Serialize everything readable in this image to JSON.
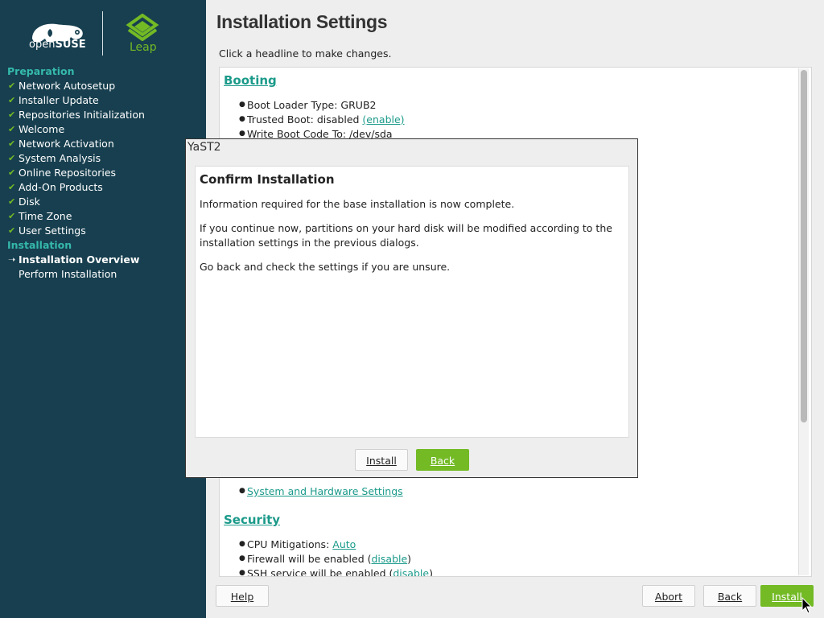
{
  "sidebar": {
    "brand": {
      "suse_prefix": "open",
      "suse_bold": "SUSE",
      "leap": "Leap"
    },
    "sections": [
      {
        "title": "Preparation",
        "steps": [
          {
            "label": "Network Autosetup",
            "state": "done"
          },
          {
            "label": "Installer Update",
            "state": "done"
          },
          {
            "label": "Repositories Initialization",
            "state": "done"
          },
          {
            "label": "Welcome",
            "state": "done"
          },
          {
            "label": "Network Activation",
            "state": "done"
          },
          {
            "label": "System Analysis",
            "state": "done"
          },
          {
            "label": "Online Repositories",
            "state": "done"
          },
          {
            "label": "Add-On Products",
            "state": "done"
          },
          {
            "label": "Disk",
            "state": "done"
          },
          {
            "label": "Time Zone",
            "state": "done"
          },
          {
            "label": "User Settings",
            "state": "done"
          }
        ]
      },
      {
        "title": "Installation",
        "steps": [
          {
            "label": "Installation Overview",
            "state": "current"
          },
          {
            "label": "Perform Installation",
            "state": "pending"
          }
        ]
      }
    ],
    "marks": {
      "done": "✔",
      "current": "➝"
    }
  },
  "main": {
    "title": "Installation Settings",
    "subtitle": "Click a headline to make changes.",
    "booting": {
      "headline": "Booting",
      "loader": "Boot Loader Type: GRUB2",
      "trusted_prefix": "Trusted Boot: disabled ",
      "trusted_link": "(enable)",
      "write_code": "Write Boot Code To: /dev/sda"
    },
    "system_link": "System and Hardware Settings",
    "security": {
      "headline": "Security",
      "cpu_prefix": "CPU Mitigations: ",
      "cpu_link": "Auto",
      "firewall_prefix": "Firewall will be enabled (",
      "firewall_link": "disable",
      "firewall_suffix": ")",
      "ssh_prefix": "SSH service will be enabled (",
      "ssh_link": "disable",
      "ssh_suffix": ")"
    }
  },
  "buttons": {
    "help": "Help",
    "abort": "Abort",
    "back": "Back",
    "install": "Install"
  },
  "dialog": {
    "window_title": "YaST2",
    "heading": "Confirm Installation",
    "p1": "Information required for the base installation is now complete.",
    "p2": "If you continue now, partitions on your hard disk will be modified according to the installation settings in the previous dialogs.",
    "p3": "Go back and check the settings if you are unsure.",
    "install": "Install",
    "back": "Back"
  },
  "colors": {
    "sidebar_bg": "#173f4f",
    "accent_green": "#73ba25",
    "section_teal": "#35b9ab",
    "link_teal": "#1b9a8a"
  }
}
